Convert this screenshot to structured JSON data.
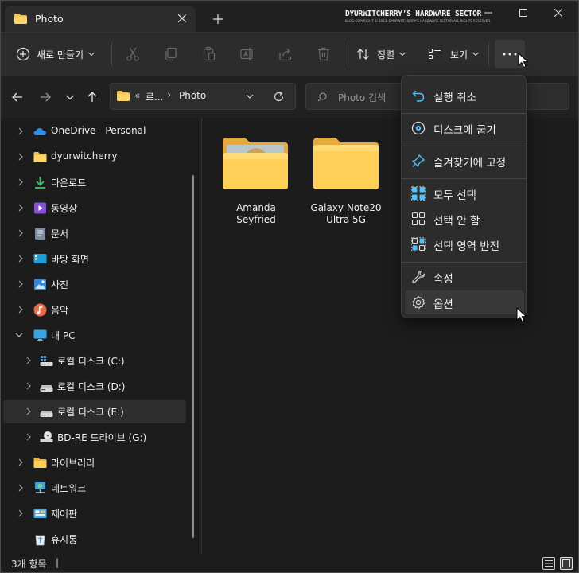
{
  "window": {
    "tab_title": "Photo",
    "tab_close_icon": "close-icon",
    "new_tab_icon": "plus-icon",
    "watermark_main": "DYURWITCHERRY'S HARDWARE SECTOR",
    "watermark_sub": "BLOG COPYRIGHT © 2013. DYURWITCHERRY'S HARDWARE SECTOR ALL RIGHTS RESERVED.",
    "controls": [
      "minimize-icon",
      "maximize-icon",
      "close-icon"
    ]
  },
  "toolbar": {
    "new_label": "새로 만들기",
    "sort_label": "정렬",
    "view_label": "보기",
    "actions": [
      "cut-icon",
      "copy-icon",
      "paste-icon",
      "rename-icon",
      "share-icon",
      "delete-icon"
    ],
    "more_icon": "more-icon"
  },
  "navigation": {
    "buttons": [
      "back-icon",
      "forward-icon",
      "chevron-down-icon",
      "up-icon"
    ],
    "breadcrumb_overflow": "«",
    "breadcrumb_1": "로...",
    "breadcrumb_sep": "›",
    "breadcrumb_current": "Photo",
    "search_placeholder": "Photo 검색"
  },
  "sidebar": {
    "items": [
      {
        "label": "OneDrive - Personal",
        "icon": "onedrive-icon"
      },
      {
        "label": "dyurwitcherry",
        "icon": "folder-icon"
      },
      {
        "label": "다운로드",
        "icon": "download-icon"
      },
      {
        "label": "동영상",
        "icon": "video-icon"
      },
      {
        "label": "문서",
        "icon": "document-icon"
      },
      {
        "label": "바탕 화면",
        "icon": "desktop-icon"
      },
      {
        "label": "사진",
        "icon": "pictures-icon"
      },
      {
        "label": "음악",
        "icon": "music-icon"
      },
      {
        "label": "내 PC",
        "icon": "pc-icon"
      },
      {
        "label": "로컬 디스크 (C:)",
        "icon": "system-drive-icon"
      },
      {
        "label": "로컬 디스크 (D:)",
        "icon": "drive-icon"
      },
      {
        "label": "로컬 디스크 (E:)",
        "icon": "drive-icon"
      },
      {
        "label": "BD-RE 드라이브 (G:)",
        "icon": "optical-drive-icon"
      },
      {
        "label": "라이브러리",
        "icon": "library-icon"
      },
      {
        "label": "네트워크",
        "icon": "network-icon"
      },
      {
        "label": "제어판",
        "icon": "control-panel-icon"
      },
      {
        "label": "휴지통",
        "icon": "recycle-bin-icon"
      }
    ]
  },
  "files": [
    {
      "name": "Amanda Seyfried",
      "icon": "photo-folder-icon"
    },
    {
      "name": "Galaxy Note20 Ultra 5G",
      "icon": "folder-icon"
    }
  ],
  "menu": {
    "items": [
      {
        "label": "실행 취소",
        "icon": "undo-icon"
      },
      {
        "label": "디스크에 굽기",
        "icon": "disc-icon"
      },
      {
        "label": "즐겨찾기에 고정",
        "icon": "pin-icon"
      },
      {
        "label": "모두 선택",
        "icon": "select-all-icon"
      },
      {
        "label": "선택 안 함",
        "icon": "select-none-icon"
      },
      {
        "label": "선택 영역 반전",
        "icon": "invert-selection-icon"
      },
      {
        "label": "속성",
        "icon": "properties-icon"
      },
      {
        "label": "옵션",
        "icon": "options-icon"
      }
    ]
  },
  "status": {
    "item_count": "3개 항목",
    "separator": "|",
    "view_icons": [
      "details-view-icon",
      "large-icons-view-icon"
    ]
  },
  "colors": {
    "accent": "#4cc2ff",
    "folder": "#f8c24a"
  }
}
